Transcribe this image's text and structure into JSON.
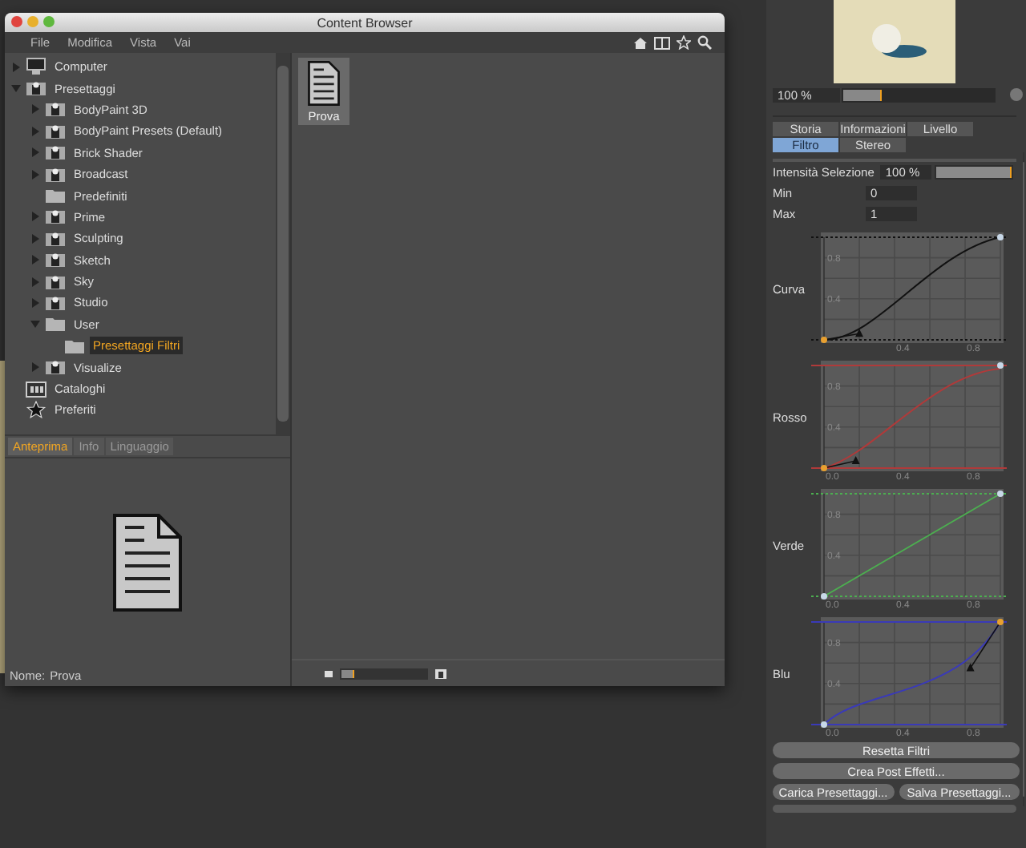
{
  "window": {
    "title": "Content Browser"
  },
  "menu": [
    "File",
    "Modifica",
    "Vista",
    "Vai"
  ],
  "tree": [
    {
      "label": "Computer",
      "kind": "computer",
      "expandable": true,
      "expanded": false,
      "selected": false
    },
    {
      "label": "Presettaggi",
      "kind": "preset",
      "expandable": true,
      "expanded": true,
      "selected": false,
      "children": [
        {
          "label": "BodyPaint 3D",
          "kind": "preset",
          "expandable": true,
          "expanded": false,
          "selected": false
        },
        {
          "label": "BodyPaint Presets (Default)",
          "kind": "preset",
          "expandable": true,
          "expanded": false,
          "selected": false
        },
        {
          "label": "Brick Shader",
          "kind": "preset",
          "expandable": true,
          "expanded": false,
          "selected": false
        },
        {
          "label": "Broadcast",
          "kind": "preset",
          "expandable": true,
          "expanded": false,
          "selected": false
        },
        {
          "label": "Predefiniti",
          "kind": "folder",
          "expandable": false,
          "selected": false
        },
        {
          "label": "Prime",
          "kind": "preset",
          "expandable": true,
          "expanded": false,
          "selected": false
        },
        {
          "label": "Sculpting",
          "kind": "preset",
          "expandable": true,
          "expanded": false,
          "selected": false
        },
        {
          "label": "Sketch",
          "kind": "preset",
          "expandable": true,
          "expanded": false,
          "selected": false
        },
        {
          "label": "Sky",
          "kind": "preset",
          "expandable": true,
          "expanded": false,
          "selected": false
        },
        {
          "label": "Studio",
          "kind": "preset",
          "expandable": true,
          "expanded": false,
          "selected": false
        },
        {
          "label": "User",
          "kind": "folder",
          "expandable": true,
          "expanded": true,
          "selected": false,
          "children": [
            {
              "label": "Presettaggi Filtri",
              "kind": "folder",
              "expandable": false,
              "selected": true
            }
          ]
        },
        {
          "label": "Visualize",
          "kind": "preset",
          "expandable": true,
          "expanded": false,
          "selected": false
        }
      ]
    },
    {
      "label": "Cataloghi",
      "kind": "catalog",
      "expandable": false,
      "selected": false
    },
    {
      "label": "Preferiti",
      "kind": "star",
      "expandable": false,
      "selected": false
    }
  ],
  "preview_tabs": [
    {
      "label": "Anteprima",
      "selected": true
    },
    {
      "label": "Info",
      "selected": false
    },
    {
      "label": "Linguaggio",
      "selected": false
    }
  ],
  "preview_name": {
    "label": "Nome:",
    "value": "Prova"
  },
  "files": [
    {
      "name": "Prova",
      "selected": true
    }
  ],
  "browser_zoom": {
    "level": 0.15
  },
  "render_zoom": {
    "value": "100 %",
    "level": 0.25
  },
  "attribute_tabs": [
    [
      {
        "label": "Storia",
        "selected": false
      },
      {
        "label": "Informazioni",
        "selected": false
      },
      {
        "label": "Livello",
        "selected": false
      }
    ],
    [
      {
        "label": "Filtro",
        "selected": true
      },
      {
        "label": "Stereo",
        "selected": false
      }
    ]
  ],
  "intensity": {
    "label": "Intensità Selezione",
    "value": "100 %",
    "level": 1
  },
  "fields": [
    {
      "label": "Min",
      "value": "0"
    },
    {
      "label": "Max",
      "value": "1"
    }
  ],
  "curves": [
    {
      "label": "Curva",
      "color": "#111111",
      "x_ticks": [
        "0.4",
        "0.8"
      ],
      "y_ticks": [
        "0.8",
        "0.4"
      ]
    },
    {
      "label": "Rosso",
      "color": "#b03a3a",
      "x_ticks": [
        "0.0",
        "0.4",
        "0.8"
      ],
      "y_ticks": [
        "0.8",
        "0.4"
      ]
    },
    {
      "label": "Verde",
      "color": "#4caf50",
      "x_ticks": [
        "0.0",
        "0.4",
        "0.8"
      ],
      "y_ticks": [
        "0.8",
        "0.4"
      ]
    },
    {
      "label": "Blu",
      "color": "#3a3ab8",
      "x_ticks": [
        "0.0",
        "0.4",
        "0.8"
      ],
      "y_ticks": [
        "0.8",
        "0.4"
      ]
    }
  ],
  "buttons": [
    [
      "Resetta Filtri"
    ],
    [
      "Crea Post Effetti..."
    ],
    [
      "Carica Presettaggi...",
      "Salva Presettaggi..."
    ]
  ]
}
